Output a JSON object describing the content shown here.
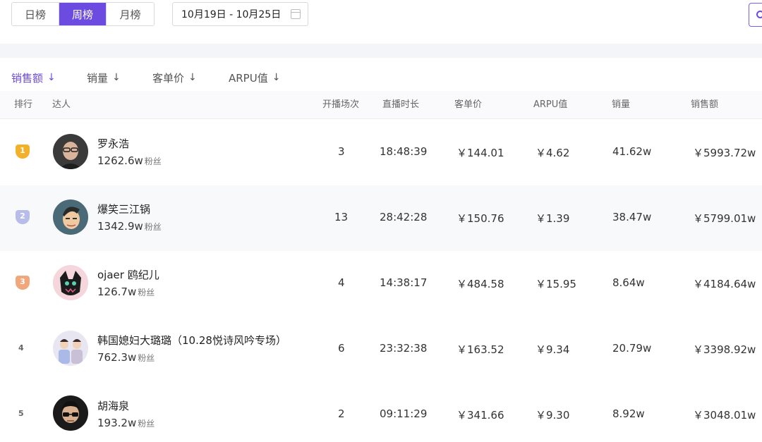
{
  "period_tabs": [
    {
      "label": "日榜",
      "active": false
    },
    {
      "label": "周榜",
      "active": true
    },
    {
      "label": "月榜",
      "active": false
    }
  ],
  "date_range": "10月19日 - 10月25日",
  "sort_tabs": [
    {
      "label": "销售额",
      "arrow": "↓",
      "active": true
    },
    {
      "label": "销量",
      "arrow": "↓",
      "active": false
    },
    {
      "label": "客单价",
      "arrow": "↓",
      "active": false
    },
    {
      "label": "ARPU值",
      "arrow": "↓",
      "active": false
    }
  ],
  "columns": {
    "rank": "排行",
    "streamer": "达人",
    "sessions": "开播场次",
    "duration": "直播时长",
    "unit_price": "客单价",
    "arpu": "ARPU值",
    "volume": "销量",
    "sales": "销售额"
  },
  "fans_unit": "粉丝",
  "rows": [
    {
      "rank": "1",
      "name": "罗永浩",
      "fans": "1262.6w",
      "sessions": "3",
      "duration": "18:48:39",
      "unit_price": "￥144.01",
      "arpu": "￥4.62",
      "volume": "41.62w",
      "sales": "￥5993.72w"
    },
    {
      "rank": "2",
      "name": "爆笑三江锅",
      "fans": "1342.9w",
      "sessions": "13",
      "duration": "28:42:28",
      "unit_price": "￥150.76",
      "arpu": "￥1.39",
      "volume": "38.47w",
      "sales": "￥5799.01w"
    },
    {
      "rank": "3",
      "name": "ojaer 鸥纪儿",
      "fans": "126.7w",
      "sessions": "4",
      "duration": "14:38:17",
      "unit_price": "￥484.58",
      "arpu": "￥15.95",
      "volume": "8.64w",
      "sales": "￥4184.64w"
    },
    {
      "rank": "4",
      "name": "韩国媳妇大璐璐（10.28悦诗风吟专场）",
      "fans": "762.3w",
      "sessions": "6",
      "duration": "23:32:38",
      "unit_price": "￥163.52",
      "arpu": "￥9.34",
      "volume": "20.79w",
      "sales": "￥3398.92w"
    },
    {
      "rank": "5",
      "name": "胡海泉",
      "fans": "193.2w",
      "sessions": "2",
      "duration": "09:11:29",
      "unit_price": "￥341.66",
      "arpu": "￥9.30",
      "volume": "8.92w",
      "sales": "￥3048.01w"
    }
  ],
  "medal_colors": {
    "gold": "#f3b12a",
    "silver": "#b7bde8",
    "bronze": "#f0a77c"
  },
  "accent_color": "#6c4be0"
}
